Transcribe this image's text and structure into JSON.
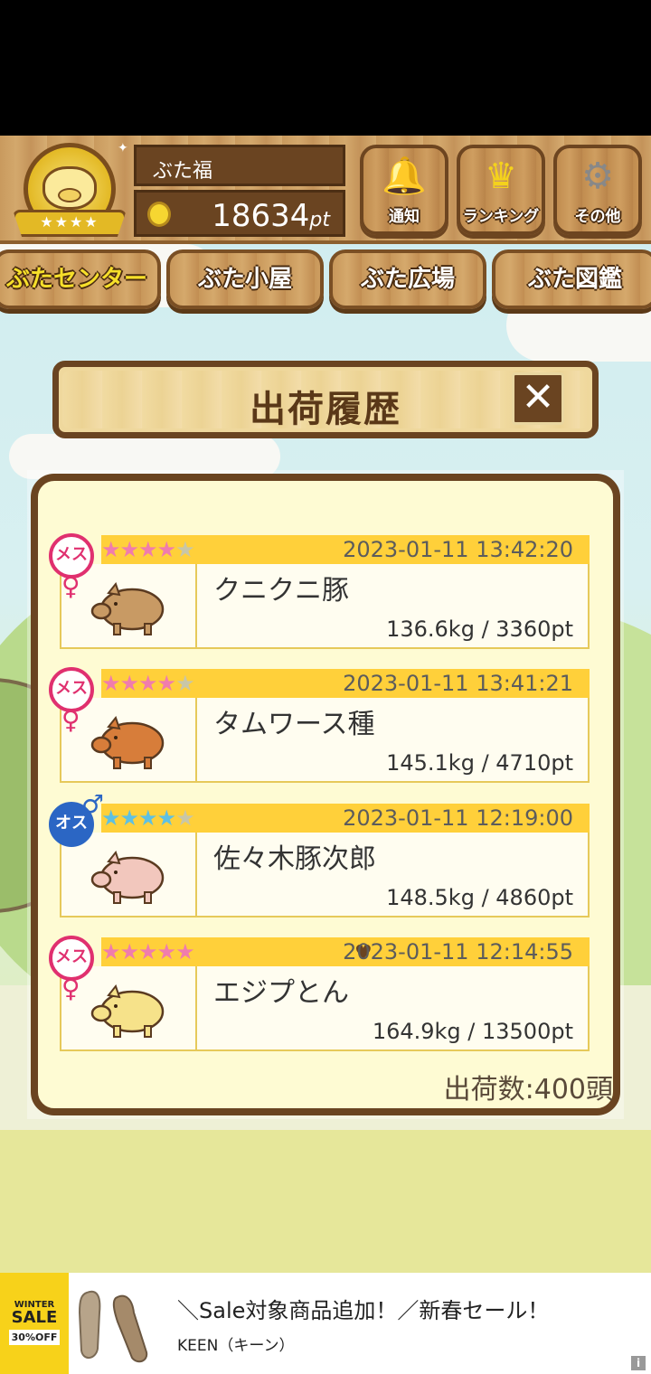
{
  "header": {
    "player_name": "ぶた福",
    "points_value": "18634",
    "points_unit": "pt",
    "buttons": [
      {
        "label": "通知",
        "icon": "bell-icon"
      },
      {
        "label": "ランキング",
        "icon": "crown-icon"
      },
      {
        "label": "その他",
        "icon": "gear-icon"
      }
    ]
  },
  "tabs": [
    "ぶたセンター",
    "ぶた小屋",
    "ぶた広場",
    "ぶた図鑑"
  ],
  "dialog": {
    "title": "出荷履歴",
    "close_label": "✕"
  },
  "history": [
    {
      "gender": "female",
      "gender_label": "メス",
      "gender_symbol": "♀",
      "stars": 4,
      "favorite": false,
      "date": "2023-01-11 13:42:20",
      "name": "クニクニ豚",
      "stats": "136.6kg / 3360pt",
      "pig_color": "#c89a64"
    },
    {
      "gender": "female",
      "gender_label": "メス",
      "gender_symbol": "♀",
      "stars": 4,
      "favorite": false,
      "date": "2023-01-11 13:41:21",
      "name": "タムワース種",
      "stats": "145.1kg / 4710pt",
      "pig_color": "#d77d3a"
    },
    {
      "gender": "male",
      "gender_label": "オス",
      "gender_symbol": "♂",
      "stars": 4,
      "favorite": false,
      "date": "2023-01-11 12:19:00",
      "name": "佐々木豚次郎",
      "stats": "148.5kg / 4860pt",
      "pig_color": "#f2c7bd"
    },
    {
      "gender": "female",
      "gender_label": "メス",
      "gender_symbol": "♀",
      "stars": 5,
      "favorite": true,
      "date": "2023-01-11 12:14:55",
      "name": "エジプとん",
      "stats": "164.9kg / 13500pt",
      "pig_color": "#f6e28a"
    }
  ],
  "summary": {
    "count_text": "出荷数:400頭"
  },
  "ad": {
    "badge_line1": "WINTER",
    "badge_line2": "SALE",
    "badge_line3": "30%OFF",
    "headline": "＼Sale対象商品追加！／新春セール！",
    "brand": "KEEN（キーン）",
    "info": "i"
  }
}
